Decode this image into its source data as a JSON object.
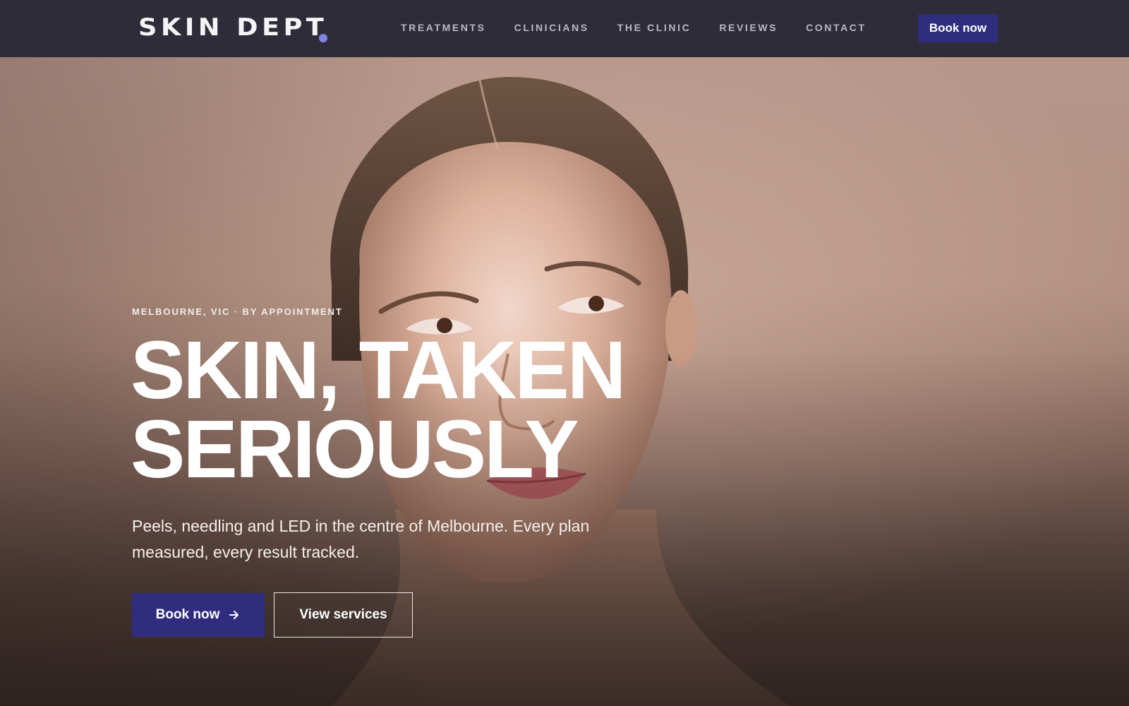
{
  "brand": {
    "name": "SKIN DEPT",
    "dot_color": "#7f86e6"
  },
  "nav": {
    "links": [
      "TREATMENTS",
      "CLINICIANS",
      "THE CLINIC",
      "REVIEWS",
      "CONTACT"
    ],
    "cta_label": "Book now"
  },
  "hero": {
    "eyebrow": "MELBOURNE, VIC · BY APPOINTMENT",
    "headline_line1": "SKIN, TAKEN",
    "headline_line2": "SERIOUSLY",
    "subcopy": "Peels, needling and LED in the centre of Melbourne. Every plan measured, every result tracked.",
    "primary_button": "Book now",
    "primary_button_icon": "arrow-right-icon",
    "secondary_button": "View services",
    "image": "portrait-photo"
  },
  "colors": {
    "nav_bg": "#2d2c38",
    "accent": "#302d7e",
    "hero_tone": "#b6968a"
  }
}
